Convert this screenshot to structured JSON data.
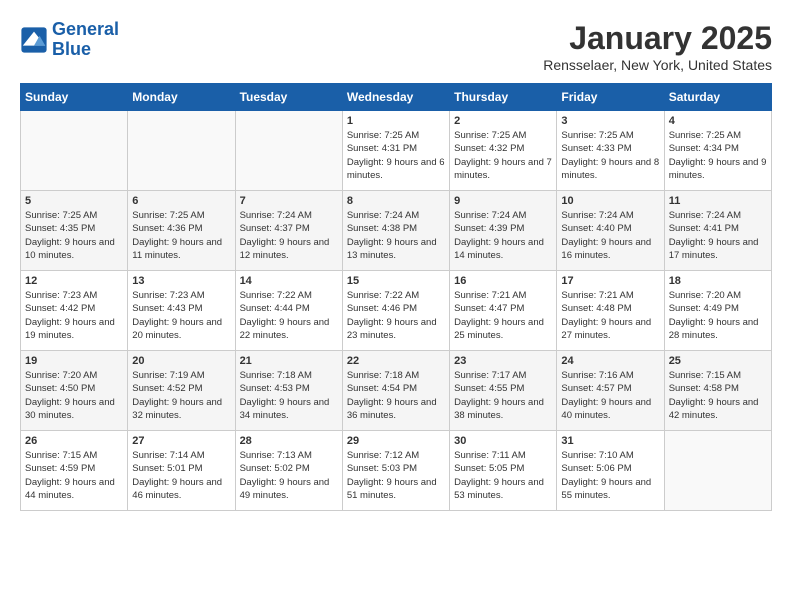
{
  "header": {
    "logo_line1": "General",
    "logo_line2": "Blue",
    "month": "January 2025",
    "location": "Rensselaer, New York, United States"
  },
  "days_of_week": [
    "Sunday",
    "Monday",
    "Tuesday",
    "Wednesday",
    "Thursday",
    "Friday",
    "Saturday"
  ],
  "weeks": [
    [
      {
        "day": "",
        "sunrise": "",
        "sunset": "",
        "daylight": ""
      },
      {
        "day": "",
        "sunrise": "",
        "sunset": "",
        "daylight": ""
      },
      {
        "day": "",
        "sunrise": "",
        "sunset": "",
        "daylight": ""
      },
      {
        "day": "1",
        "sunrise": "Sunrise: 7:25 AM",
        "sunset": "Sunset: 4:31 PM",
        "daylight": "Daylight: 9 hours and 6 minutes."
      },
      {
        "day": "2",
        "sunrise": "Sunrise: 7:25 AM",
        "sunset": "Sunset: 4:32 PM",
        "daylight": "Daylight: 9 hours and 7 minutes."
      },
      {
        "day": "3",
        "sunrise": "Sunrise: 7:25 AM",
        "sunset": "Sunset: 4:33 PM",
        "daylight": "Daylight: 9 hours and 8 minutes."
      },
      {
        "day": "4",
        "sunrise": "Sunrise: 7:25 AM",
        "sunset": "Sunset: 4:34 PM",
        "daylight": "Daylight: 9 hours and 9 minutes."
      }
    ],
    [
      {
        "day": "5",
        "sunrise": "Sunrise: 7:25 AM",
        "sunset": "Sunset: 4:35 PM",
        "daylight": "Daylight: 9 hours and 10 minutes."
      },
      {
        "day": "6",
        "sunrise": "Sunrise: 7:25 AM",
        "sunset": "Sunset: 4:36 PM",
        "daylight": "Daylight: 9 hours and 11 minutes."
      },
      {
        "day": "7",
        "sunrise": "Sunrise: 7:24 AM",
        "sunset": "Sunset: 4:37 PM",
        "daylight": "Daylight: 9 hours and 12 minutes."
      },
      {
        "day": "8",
        "sunrise": "Sunrise: 7:24 AM",
        "sunset": "Sunset: 4:38 PM",
        "daylight": "Daylight: 9 hours and 13 minutes."
      },
      {
        "day": "9",
        "sunrise": "Sunrise: 7:24 AM",
        "sunset": "Sunset: 4:39 PM",
        "daylight": "Daylight: 9 hours and 14 minutes."
      },
      {
        "day": "10",
        "sunrise": "Sunrise: 7:24 AM",
        "sunset": "Sunset: 4:40 PM",
        "daylight": "Daylight: 9 hours and 16 minutes."
      },
      {
        "day": "11",
        "sunrise": "Sunrise: 7:24 AM",
        "sunset": "Sunset: 4:41 PM",
        "daylight": "Daylight: 9 hours and 17 minutes."
      }
    ],
    [
      {
        "day": "12",
        "sunrise": "Sunrise: 7:23 AM",
        "sunset": "Sunset: 4:42 PM",
        "daylight": "Daylight: 9 hours and 19 minutes."
      },
      {
        "day": "13",
        "sunrise": "Sunrise: 7:23 AM",
        "sunset": "Sunset: 4:43 PM",
        "daylight": "Daylight: 9 hours and 20 minutes."
      },
      {
        "day": "14",
        "sunrise": "Sunrise: 7:22 AM",
        "sunset": "Sunset: 4:44 PM",
        "daylight": "Daylight: 9 hours and 22 minutes."
      },
      {
        "day": "15",
        "sunrise": "Sunrise: 7:22 AM",
        "sunset": "Sunset: 4:46 PM",
        "daylight": "Daylight: 9 hours and 23 minutes."
      },
      {
        "day": "16",
        "sunrise": "Sunrise: 7:21 AM",
        "sunset": "Sunset: 4:47 PM",
        "daylight": "Daylight: 9 hours and 25 minutes."
      },
      {
        "day": "17",
        "sunrise": "Sunrise: 7:21 AM",
        "sunset": "Sunset: 4:48 PM",
        "daylight": "Daylight: 9 hours and 27 minutes."
      },
      {
        "day": "18",
        "sunrise": "Sunrise: 7:20 AM",
        "sunset": "Sunset: 4:49 PM",
        "daylight": "Daylight: 9 hours and 28 minutes."
      }
    ],
    [
      {
        "day": "19",
        "sunrise": "Sunrise: 7:20 AM",
        "sunset": "Sunset: 4:50 PM",
        "daylight": "Daylight: 9 hours and 30 minutes."
      },
      {
        "day": "20",
        "sunrise": "Sunrise: 7:19 AM",
        "sunset": "Sunset: 4:52 PM",
        "daylight": "Daylight: 9 hours and 32 minutes."
      },
      {
        "day": "21",
        "sunrise": "Sunrise: 7:18 AM",
        "sunset": "Sunset: 4:53 PM",
        "daylight": "Daylight: 9 hours and 34 minutes."
      },
      {
        "day": "22",
        "sunrise": "Sunrise: 7:18 AM",
        "sunset": "Sunset: 4:54 PM",
        "daylight": "Daylight: 9 hours and 36 minutes."
      },
      {
        "day": "23",
        "sunrise": "Sunrise: 7:17 AM",
        "sunset": "Sunset: 4:55 PM",
        "daylight": "Daylight: 9 hours and 38 minutes."
      },
      {
        "day": "24",
        "sunrise": "Sunrise: 7:16 AM",
        "sunset": "Sunset: 4:57 PM",
        "daylight": "Daylight: 9 hours and 40 minutes."
      },
      {
        "day": "25",
        "sunrise": "Sunrise: 7:15 AM",
        "sunset": "Sunset: 4:58 PM",
        "daylight": "Daylight: 9 hours and 42 minutes."
      }
    ],
    [
      {
        "day": "26",
        "sunrise": "Sunrise: 7:15 AM",
        "sunset": "Sunset: 4:59 PM",
        "daylight": "Daylight: 9 hours and 44 minutes."
      },
      {
        "day": "27",
        "sunrise": "Sunrise: 7:14 AM",
        "sunset": "Sunset: 5:01 PM",
        "daylight": "Daylight: 9 hours and 46 minutes."
      },
      {
        "day": "28",
        "sunrise": "Sunrise: 7:13 AM",
        "sunset": "Sunset: 5:02 PM",
        "daylight": "Daylight: 9 hours and 49 minutes."
      },
      {
        "day": "29",
        "sunrise": "Sunrise: 7:12 AM",
        "sunset": "Sunset: 5:03 PM",
        "daylight": "Daylight: 9 hours and 51 minutes."
      },
      {
        "day": "30",
        "sunrise": "Sunrise: 7:11 AM",
        "sunset": "Sunset: 5:05 PM",
        "daylight": "Daylight: 9 hours and 53 minutes."
      },
      {
        "day": "31",
        "sunrise": "Sunrise: 7:10 AM",
        "sunset": "Sunset: 5:06 PM",
        "daylight": "Daylight: 9 hours and 55 minutes."
      },
      {
        "day": "",
        "sunrise": "",
        "sunset": "",
        "daylight": ""
      }
    ]
  ]
}
